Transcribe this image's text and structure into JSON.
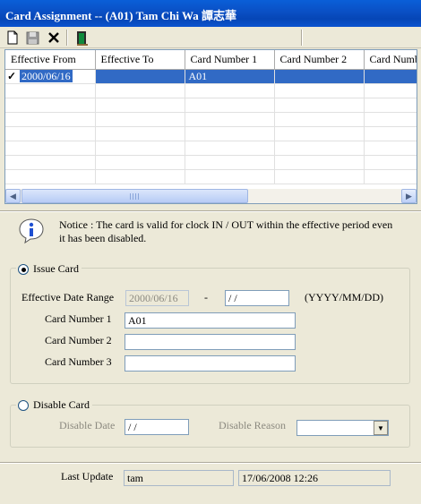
{
  "window": {
    "title": "Card Assignment -- (A01) Tam Chi Wa 譚志華"
  },
  "toolbar": {
    "icons": [
      "new-document-icon",
      "save-icon",
      "delete-icon",
      "exit-door-icon"
    ]
  },
  "grid": {
    "columns": [
      "Effective From",
      "Effective To",
      "Card Number 1",
      "Card Number 2",
      "Card Numb"
    ],
    "rows": [
      {
        "effective_from": "2000/06/16",
        "effective_to": "",
        "card1": "A01",
        "card2": "",
        "card3": "",
        "selected": true
      }
    ]
  },
  "notice": {
    "text": "Notice : The card is valid for clock IN / OUT within the effective period even it has been disabled."
  },
  "issue_card": {
    "label": "Issue Card",
    "selected": true,
    "effective_range_label": "Effective Date Range",
    "date_from": "2000/06/16",
    "dash": "-",
    "date_to": " / /",
    "date_format": "(YYYY/MM/DD)",
    "card1_label": "Card Number 1",
    "card1_value": "A01",
    "card2_label": "Card Number 2",
    "card2_value": "",
    "card3_label": "Card Number 3",
    "card3_value": ""
  },
  "disable_card": {
    "label": "Disable Card",
    "selected": false,
    "date_label": "Disable Date",
    "date_value": " / /",
    "reason_label": "Disable Reason",
    "reason_value": ""
  },
  "last_update": {
    "label": "Last Update",
    "user": "tam",
    "timestamp": "17/06/2008 12:26"
  }
}
